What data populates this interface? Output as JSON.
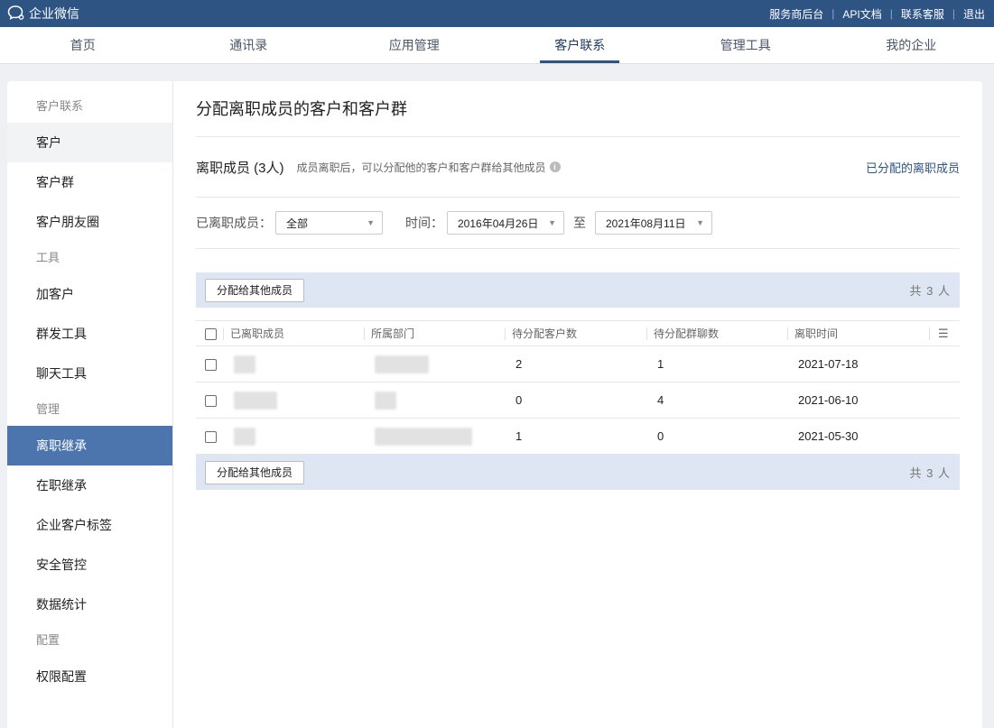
{
  "topbar": {
    "brand": "企业微信",
    "links": [
      "服务商后台",
      "API文档",
      "联系客服",
      "退出"
    ]
  },
  "nav": [
    "首页",
    "通讯录",
    "应用管理",
    "客户联系",
    "管理工具",
    "我的企业"
  ],
  "sidebar": {
    "group1": "客户联系",
    "g1items": [
      "客户",
      "客户群",
      "客户朋友圈"
    ],
    "group2": "工具",
    "g2items": [
      "加客户",
      "群发工具",
      "聊天工具"
    ],
    "group3": "管理",
    "g3items": [
      "离职继承",
      "在职继承",
      "企业客户标签",
      "安全管控",
      "数据统计"
    ],
    "group4": "配置",
    "g4items": [
      "权限配置"
    ]
  },
  "page": {
    "title": "分配离职成员的客户和客户群",
    "section_title": "离职成员 (3人)",
    "section_desc": "成员离职后，可以分配他的客户和客户群给其他成员",
    "section_link": "已分配的离职成员"
  },
  "filters": {
    "member_label": "已离职成员：",
    "member_value": "全部",
    "time_label": "时间：",
    "start_date": "2016年04月26日",
    "to": "至",
    "end_date": "2021年08月11日"
  },
  "actions": {
    "assign_button": "分配给其他成员",
    "total": "共 3 人"
  },
  "table": {
    "headers": [
      "已离职成员",
      "所属部门",
      "待分配客户数",
      "待分配群聊数",
      "离职时间"
    ],
    "rows": [
      {
        "customers": "2",
        "groups": "1",
        "date": "2021-07-18"
      },
      {
        "customers": "0",
        "groups": "4",
        "date": "2021-06-10"
      },
      {
        "customers": "1",
        "groups": "0",
        "date": "2021-05-30"
      }
    ]
  },
  "colors": {
    "topbar": "#2e5484",
    "accent": "#4c75ae",
    "action_bar": "#dde6f2"
  }
}
